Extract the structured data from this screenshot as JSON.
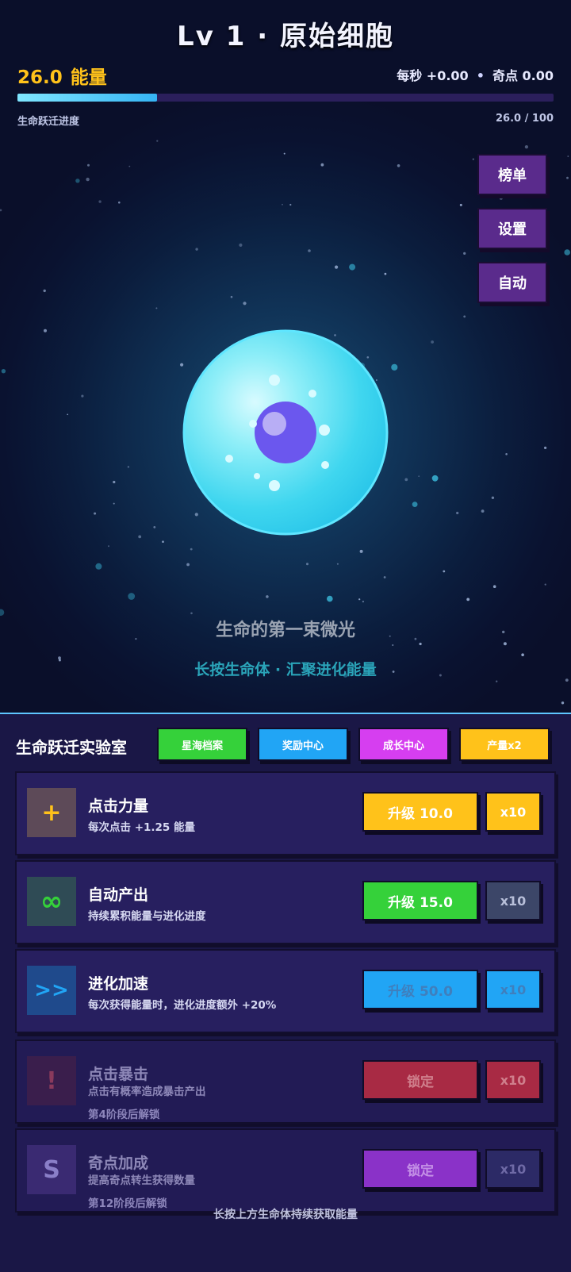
{
  "header": {
    "title": "Lv 1 · 原始细胞",
    "energy_value": "26.0",
    "energy_label": "能量",
    "per_second": "每秒 +0.00",
    "separator": "•",
    "singularity": "奇点 0.00"
  },
  "progress": {
    "label": "生命跃迁进度",
    "value_text": "26.0 / 100",
    "fraction": 0.26
  },
  "side_menu": [
    "榜单",
    "设置",
    "自动"
  ],
  "organism": {
    "tagline": "生命的第一束微光",
    "hint": "长按生命体 · 汇聚进化能量"
  },
  "lab": {
    "title": "生命跃迁实验室",
    "tabs": [
      {
        "label": "星海档案",
        "color": "#35d13a"
      },
      {
        "label": "奖励中心",
        "color": "#21a5f5"
      },
      {
        "label": "成长中心",
        "color": "#d63ef0"
      },
      {
        "label": "产量x2",
        "color": "#ffc21a"
      }
    ],
    "upgrades": [
      {
        "icon": "plus-icon",
        "glyph": "+",
        "name": "点击力量",
        "desc": "每次点击 +1.25 能量",
        "unlock": "",
        "button": "升级 10.0",
        "multi": "x10",
        "state": "affordable"
      },
      {
        "icon": "infinity-icon",
        "glyph": "∞",
        "name": "自动产出",
        "desc": "持续累积能量与进化进度",
        "unlock": "",
        "button": "升级 15.0",
        "multi": "x10",
        "state": "affordable"
      },
      {
        "icon": "fast-forward-icon",
        "glyph": ">>",
        "name": "进化加速",
        "desc": "每次获得能量时，进化进度额外 +20%",
        "unlock": "",
        "button": "升级 50.0",
        "multi": "x10",
        "state": "unaffordable"
      },
      {
        "icon": "exclamation-icon",
        "glyph": "!",
        "name": "点击暴击",
        "desc": "点击有概率造成暴击产出",
        "unlock": "第4阶段后解锁",
        "button": "锁定",
        "multi": "x10",
        "state": "locked"
      },
      {
        "icon": "s-letter-icon",
        "glyph": "S",
        "name": "奇点加成",
        "desc": "提高奇点转生获得数量",
        "unlock": "第12阶段后解锁",
        "button": "锁定",
        "multi": "x10",
        "state": "locked"
      }
    ],
    "footer": "长按上方生命体持续获取能量"
  },
  "colors": {
    "energy": "#ffc21a",
    "accent_blue": "#21a5f5",
    "accent_green": "#35d13a",
    "accent_purple": "#5a2b8c",
    "cell": "#2ad8f0",
    "nucleus": "#6a55f0"
  }
}
